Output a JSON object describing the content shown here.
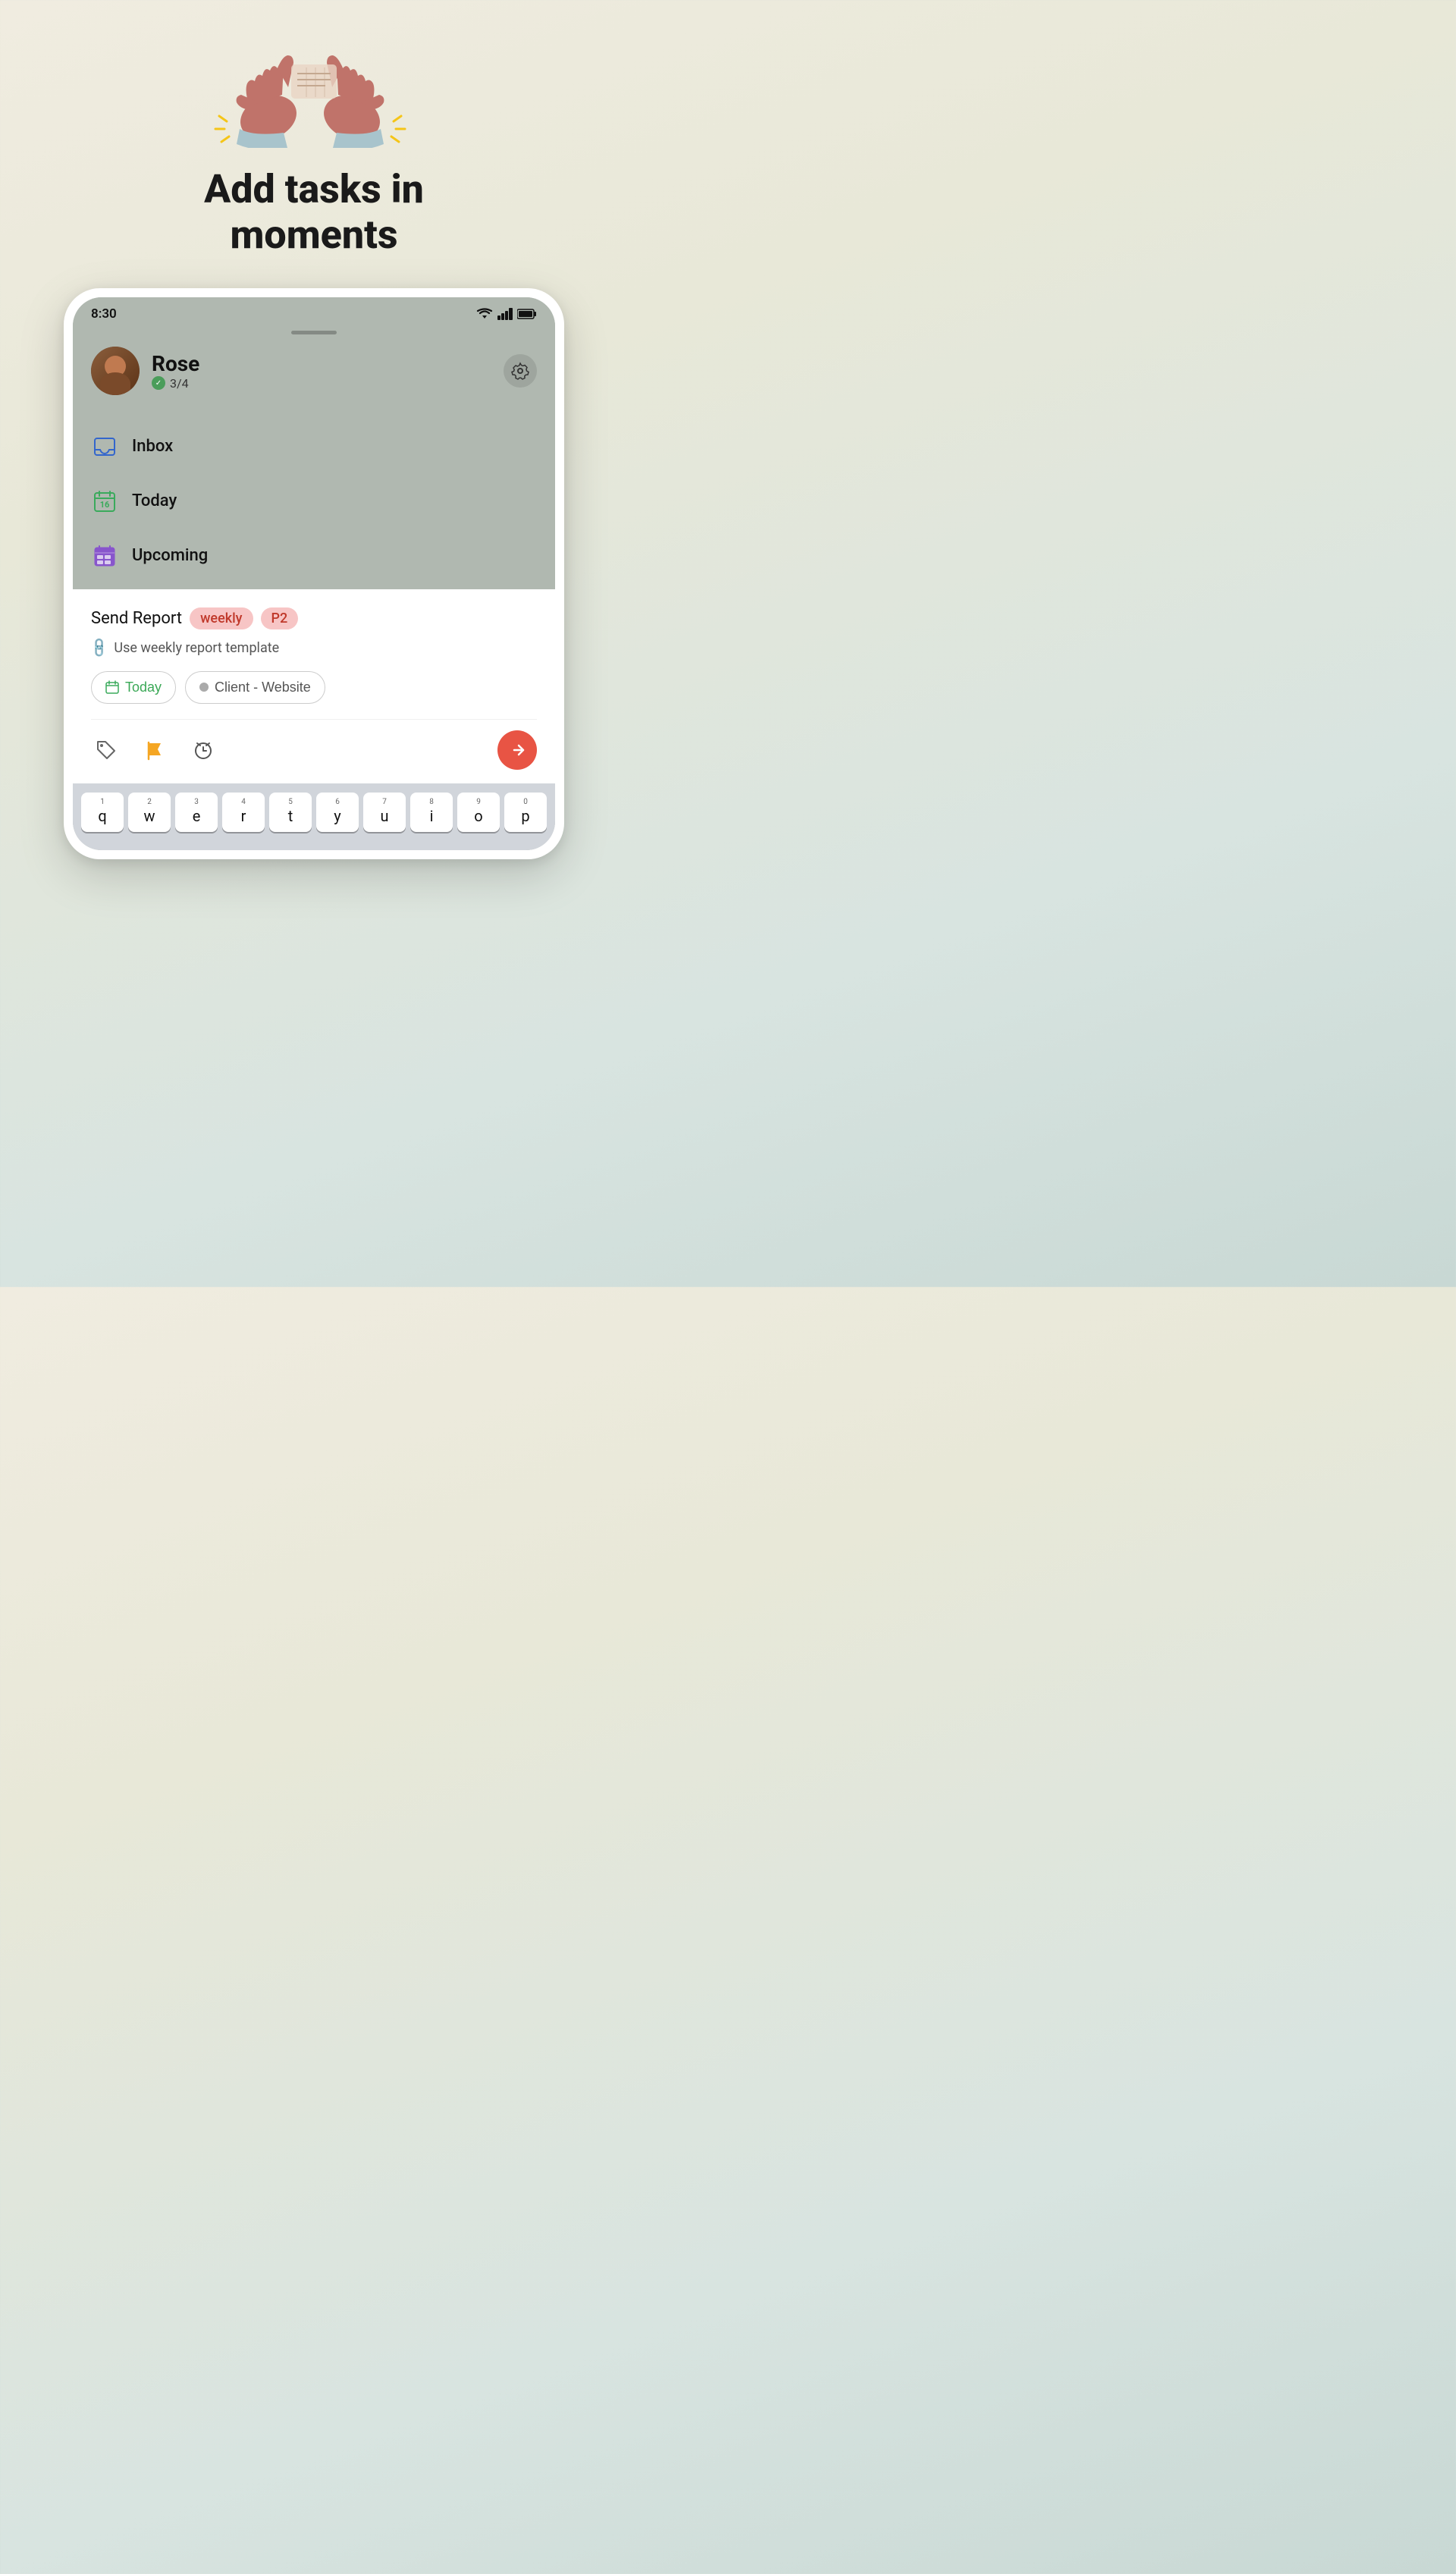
{
  "hero": {
    "title_line1": "Add tasks in",
    "title_line2": "moments"
  },
  "statusBar": {
    "time": "8:30"
  },
  "profile": {
    "name": "Rose",
    "tasks_count": "3/4"
  },
  "menu": {
    "items": [
      {
        "id": "inbox",
        "label": "Inbox",
        "icon": "inbox"
      },
      {
        "id": "today",
        "label": "Today",
        "icon": "today"
      },
      {
        "id": "upcoming",
        "label": "Upcoming",
        "icon": "upcoming"
      }
    ]
  },
  "taskInput": {
    "text": "Send Report",
    "tag_weekly": "weekly",
    "tag_p2": "P2",
    "template_text": "Use weekly report template",
    "date_btn": "Today",
    "project_btn": "Client - Website"
  },
  "keyboard": {
    "rows": [
      [
        {
          "num": "1",
          "letter": "q"
        },
        {
          "num": "2",
          "letter": "w"
        },
        {
          "num": "3",
          "letter": "e"
        },
        {
          "num": "4",
          "letter": "r"
        },
        {
          "num": "5",
          "letter": "t"
        },
        {
          "num": "6",
          "letter": "y"
        },
        {
          "num": "7",
          "letter": "u"
        },
        {
          "num": "8",
          "letter": "i"
        },
        {
          "num": "9",
          "letter": "o"
        },
        {
          "num": "0",
          "letter": "p"
        }
      ]
    ]
  }
}
